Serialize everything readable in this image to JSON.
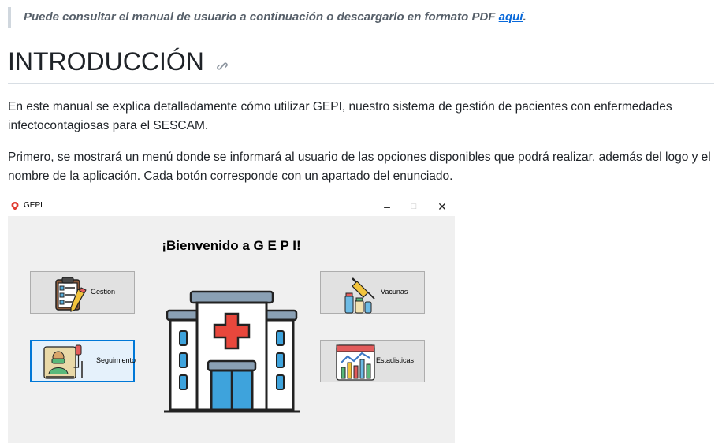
{
  "note": {
    "text": "Puede consultar el manual de usuario a continuación o descargarlo en formato PDF ",
    "link": "aquí",
    "end": "."
  },
  "heading": "INTRODUCCIÓN",
  "paragraphs": [
    "En este manual se explica detalladamente cómo utilizar GEPI, nuestro sistema de gestión de pacientes con enfermedades infectocontagiosas para el SESCAM.",
    "Primero, se mostrará un menú donde se informará al usuario de las opciones disponibles que podrá realizar, además del logo y el nombre de la aplicación. Cada botón corresponde con un apartado del enunciado."
  ],
  "app": {
    "title": "GEPI",
    "controls": {
      "minimize": "–",
      "maximize": "□",
      "close": "✕"
    },
    "welcome": "¡Bienvenido a G E P I!",
    "buttons": {
      "gestion": "Gestion",
      "seguimiento": "Seguimiento",
      "vacunas": "Vacunas",
      "estadisticas": "Estadisticas"
    }
  }
}
